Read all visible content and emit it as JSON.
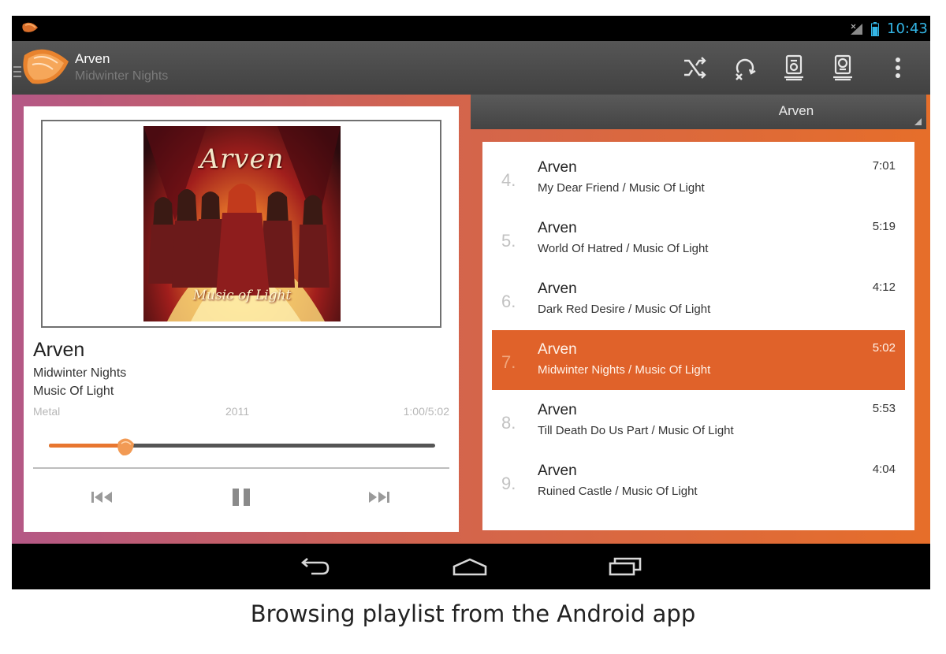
{
  "status_bar": {
    "time": "10:43",
    "time_color": "#33b5e5"
  },
  "action_bar": {
    "title": "Arven",
    "subtitle": "Midwinter Nights",
    "actions": [
      {
        "icon": "shuffle-icon"
      },
      {
        "icon": "repeat-icon"
      },
      {
        "icon": "player-device-icon"
      },
      {
        "icon": "output-device-icon"
      },
      {
        "icon": "overflow-menu-icon"
      }
    ]
  },
  "album_art": {
    "band_title": "Arven",
    "album_title": "Music of Light"
  },
  "now_playing": {
    "artist": "Arven",
    "track": "Midwinter Nights",
    "album": "Music Of Light",
    "genre": "Metal",
    "year": "2011",
    "time": "1:00/5:02",
    "progress_fraction": 0.2
  },
  "playlist_header": {
    "label": "Arven"
  },
  "playlist": [
    {
      "num": "4.",
      "artist": "Arven",
      "subtitle": "My Dear Friend / Music Of Light",
      "duration": "7:01",
      "active": false
    },
    {
      "num": "5.",
      "artist": "Arven",
      "subtitle": "World Of Hatred / Music Of Light",
      "duration": "5:19",
      "active": false
    },
    {
      "num": "6.",
      "artist": "Arven",
      "subtitle": "Dark Red Desire / Music Of Light",
      "duration": "4:12",
      "active": false
    },
    {
      "num": "7.",
      "artist": "Arven",
      "subtitle": "Midwinter Nights / Music Of Light",
      "duration": "5:02",
      "active": true
    },
    {
      "num": "8.",
      "artist": "Arven",
      "subtitle": "Till Death Do Us Part / Music Of Light",
      "duration": "5:53",
      "active": false
    },
    {
      "num": "9.",
      "artist": "Arven",
      "subtitle": "Ruined Castle / Music Of Light",
      "duration": "4:04",
      "active": false
    }
  ],
  "colors": {
    "accent": "#e0622a",
    "accent_light": "#e8762f"
  },
  "caption": "Browsing playlist from the Android app"
}
